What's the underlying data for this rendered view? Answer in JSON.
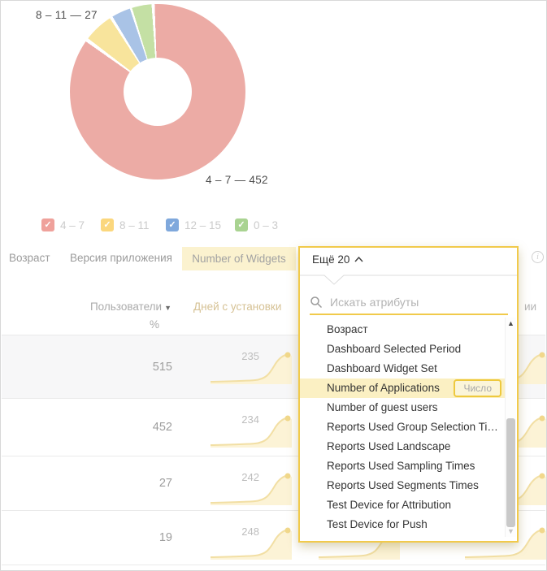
{
  "chart_data": {
    "type": "pie",
    "donut": true,
    "title": "",
    "segments": [
      {
        "label": "4 – 7",
        "value": 452,
        "color": "#ecaba5"
      },
      {
        "label": "8 – 11",
        "value": 27,
        "color": "#f8e49c"
      },
      {
        "label": "12 – 15",
        "value": null,
        "color": "#a9c3e6"
      },
      {
        "label": "0 – 3",
        "value": null,
        "color": "#c4e0a4"
      }
    ],
    "annotations": [
      "8 – 11 — 27",
      "4 – 7 — 452"
    ],
    "legend_position": "bottom"
  },
  "donut": {
    "annotation_top": "8 – 11 — 27",
    "annotation_bottom": "4 – 7 — 452"
  },
  "legend": {
    "items": [
      {
        "label": "4 – 7",
        "color": "#efa19b"
      },
      {
        "label": "8 – 11",
        "color": "#fbd77d"
      },
      {
        "label": "12 – 15",
        "color": "#7fa8dc"
      },
      {
        "label": "0 – 3",
        "color": "#a9d391"
      }
    ]
  },
  "tabs": {
    "age": "Возраст",
    "app_version": "Версия приложения",
    "number_of_widgets": "Number of Widgets"
  },
  "dropdown": {
    "trigger_label": "Ещё 20",
    "search_placeholder": "Искать атрибуты",
    "items": [
      {
        "label": "Возраст"
      },
      {
        "label": "Dashboard Selected Period"
      },
      {
        "label": "Dashboard Widget Set"
      },
      {
        "label": "Number of Applications",
        "badge": "Число"
      },
      {
        "label": "Number of guest users"
      },
      {
        "label": "Reports Used Group Selection Ti…"
      },
      {
        "label": "Reports Used Landscape"
      },
      {
        "label": "Reports Used Sampling Times"
      },
      {
        "label": "Reports Used Segments Times"
      },
      {
        "label": "Test Device for Attribution"
      },
      {
        "label": "Test Device for Push"
      }
    ]
  },
  "table": {
    "header": {
      "users": "Пользователи",
      "users_sub": "%",
      "days_since_install": "Дней с установки",
      "right_fragment": "ии"
    },
    "rows": [
      {
        "users": "515",
        "spark_label": "235"
      },
      {
        "users": "452",
        "spark_label": "234"
      },
      {
        "users": "27",
        "spark_label": "242"
      },
      {
        "users": "19",
        "spark_label": "248"
      }
    ]
  },
  "icons": {
    "check": "✓",
    "sort_desc": "▼",
    "scroll_up": "▲",
    "scroll_down": "▼",
    "info": "i"
  },
  "colors": {
    "accent_yellow": "#f1ca4b",
    "highlight_row": "#fbf0c3",
    "tab_highlight": "#fbf2cf",
    "spark_fill": "#fcf3d6",
    "spark_line": "#f2dfa4"
  }
}
